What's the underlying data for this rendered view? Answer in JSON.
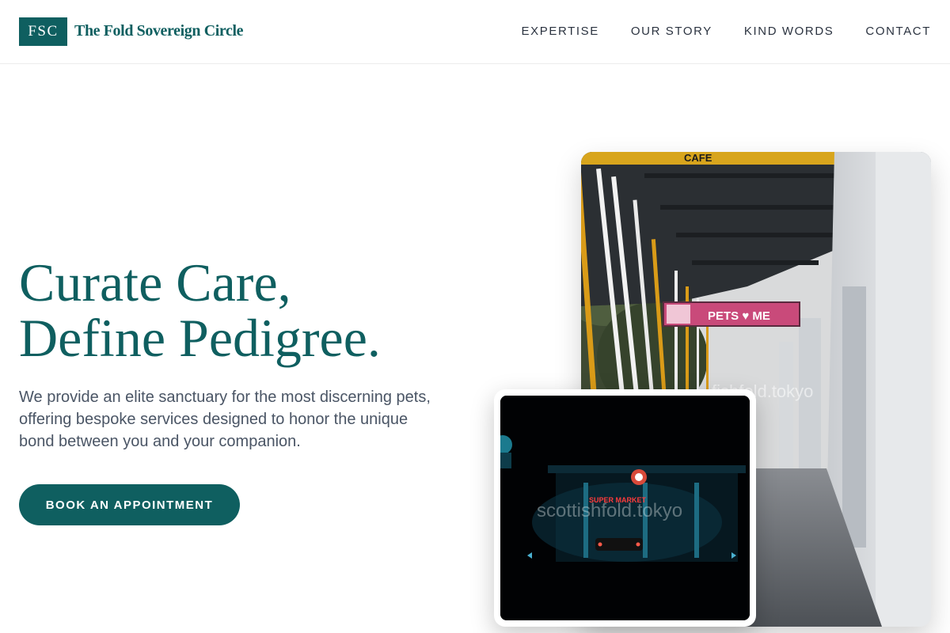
{
  "header": {
    "logo_badge": "FSC",
    "logo_name": "The Fold Sovereign Circle",
    "nav": [
      "EXPERTISE",
      "OUR STORY",
      "KIND WORDS",
      "CONTACT"
    ]
  },
  "hero": {
    "title_line1": "Curate Care,",
    "title_line2": "Define Pedigree.",
    "description": "We provide an elite sanctuary for the most discerning pets, offering bespoke services designed to honor the unique bond between you and your companion.",
    "cta_label": "BOOK AN APPOINTMENT"
  },
  "images": {
    "main": {
      "sign_cafe": "CAFE",
      "sign_pets": "PETS ♥ ME",
      "watermark": "fishfold.tokyo"
    },
    "small": {
      "sign_supermarket": "SUPER MARKET",
      "watermark": "scottishfold.tokyo"
    }
  },
  "colors": {
    "brand": "#0f5f60",
    "text": "#4a5565",
    "nav_text": "#2b3340"
  }
}
